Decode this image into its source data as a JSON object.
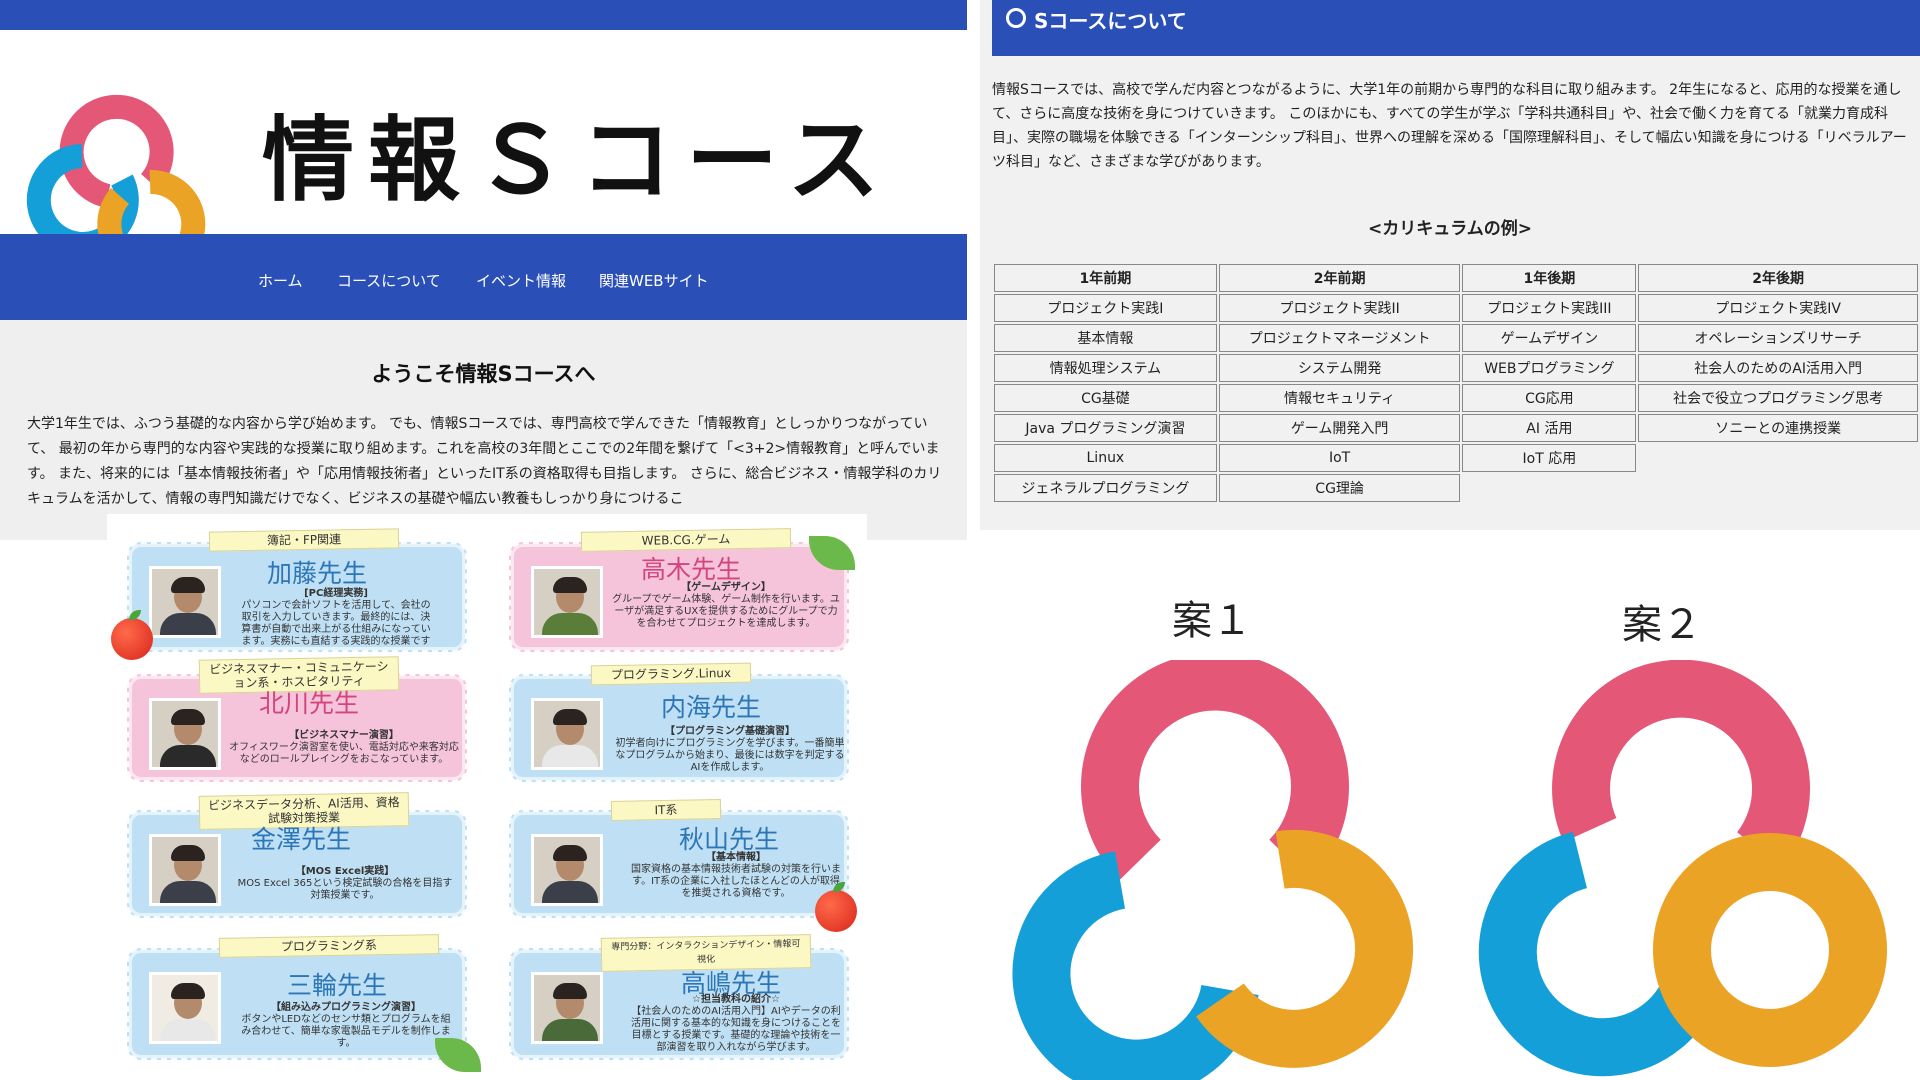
{
  "site": {
    "title": "情報Ｓコース",
    "nav": [
      "ホーム",
      "コースについて",
      "イベント情報",
      "関連WEBサイト"
    ],
    "welcome": "ようこそ情報Sコースへ",
    "intro": "大学1年生では、ふつう基礎的な内容から学び始めます。 でも、情報Sコースでは、専門高校で学んできた「情報教育」としっかりつながっていて、 最初の年から専門的な内容や実践的な授業に取り組めます。これを高校の3年間とここでの2年間を繋げて「<3+2>情報教育」と呼んでいます。 また、将来的には「基本情報技術者」や「応用情報技術者」といったIT系の資格取得も目指します。 さらに、総合ビジネス・情報学科のカリキュラムを活かして、情報の専門知識だけでなく、ビジネスの基礎や幅広い教養もしっかり身につけるこ"
  },
  "teachers": [
    {
      "tag": "簿記・FP関連",
      "name": "加藤先生",
      "heading": "[PC経理実務]",
      "desc": "パソコンで会計ソフトを活用して、会社の取引を入力していきます。最終的には、決算書が自動で出来上がる仕組みになっています。実務にも直結する実践的な授業です",
      "color": "blue"
    },
    {
      "tag": "WEB.CG.ゲーム",
      "name": "高木先生",
      "heading": "【ゲームデザイン】",
      "desc": "グループでゲーム体験、ゲーム制作を行います。ユーザが満足するUXを提供するためにグループで力を合わせてプロジェクトを達成します。",
      "color": "pink"
    },
    {
      "tag": "ビジネスマナー・コミュニケーション系・ホスピタリティ",
      "name": "北川先生",
      "heading": "【ビジネスマナー演習】",
      "desc": "オフィスワーク演習室を使い、電話対応や来客対応などのロールプレイングをおこなっています。",
      "color": "pink"
    },
    {
      "tag": "プログラミング.Linux",
      "name": "内海先生",
      "heading": "【プログラミング基礎演習】",
      "desc": "初学者向けにプログラミングを学びます。一番簡単なプログラムから始まり、最後には数字を判定するAIを作成します。",
      "color": "blue"
    },
    {
      "tag": "ビジネスデータ分析、AI活用、資格試験対策授業",
      "name": "金澤先生",
      "heading": "【MOS Excel実践】",
      "desc": "MOS Excel 365という検定試験の合格を目指す対策授業です。",
      "color": "blue"
    },
    {
      "tag": "IT系",
      "name": "秋山先生",
      "heading": "【基本情報】",
      "desc": "国家資格の基本情報技術者試験の対策を行います。IT系の企業に入社したほとんどの人が取得を推奨される資格です。",
      "color": "blue"
    },
    {
      "tag": "プログラミング系",
      "name": "三輪先生",
      "heading": "【組み込みプログラミング演習】",
      "desc": "ボタンやLEDなどのセンサ類とプログラムを組み合わせて、簡単な家電製品モデルを制作します。",
      "color": "blue"
    },
    {
      "tag": "専門分野：インタラクションデザイン・情報可視化",
      "name": "高嶋先生",
      "heading": "☆担当教科の紹介☆",
      "desc": "【社会人のためのAI活用入門】AIやデータの利活用に関する基本的な知識を身につけることを目標とする授業です。基礎的な理論や技術を一部演習を取り入れながら学びます。",
      "color": "blue"
    }
  ],
  "course": {
    "heading": "Sコースについて",
    "paragraph": "情報Sコースでは、高校で学んだ内容とつながるように、大学1年の前期から専門的な科目に取り組みます。 2年生になると、応用的な授業を通して、さらに高度な技術を身につけていきます。 このほかにも、すべての学生が学ぶ「学科共通科目」や、社会で働く力を育てる「就業力育成科目」、実際の職場を体験できる「インターンシップ科目」、世界への理解を深める「国際理解科目」、そして幅広い知識を身につける「リベラルアーツ科目」など、さまざまな学びがあります。",
    "curriculum_title": "<カリキュラムの例>",
    "columns": [
      "1年前期",
      "2年前期",
      "1年後期",
      "2年後期"
    ],
    "rows": [
      [
        "プロジェクト実践I",
        "プロジェクト実践II",
        "プロジェクト実践III",
        "プロジェクト実践IV"
      ],
      [
        "基本情報",
        "プロジェクトマネージメント",
        "ゲームデザイン",
        "オペレーションズリサーチ"
      ],
      [
        "情報処理システム",
        "システム開発",
        "WEBプログラミング",
        "社会人のためのAI活用入門"
      ],
      [
        "CG基礎",
        "情報セキュリティ",
        "CG応用",
        "社会で役立つプログラミング思考"
      ],
      [
        "Java プログラミング演習",
        "ゲーム開発入門",
        "AI 活用",
        "ソニーとの連携授業"
      ],
      [
        "Linux",
        "IoT",
        "IoT 応用",
        ""
      ],
      [
        "ジェネラルプログラミング",
        "CG理論",
        "",
        ""
      ]
    ]
  },
  "plans": [
    "案１",
    "案２"
  ],
  "colors": {
    "brand_blue": "#2a4fb7",
    "logo_red": "#e45776",
    "logo_blue": "#149fd9",
    "logo_orange": "#eba325"
  }
}
